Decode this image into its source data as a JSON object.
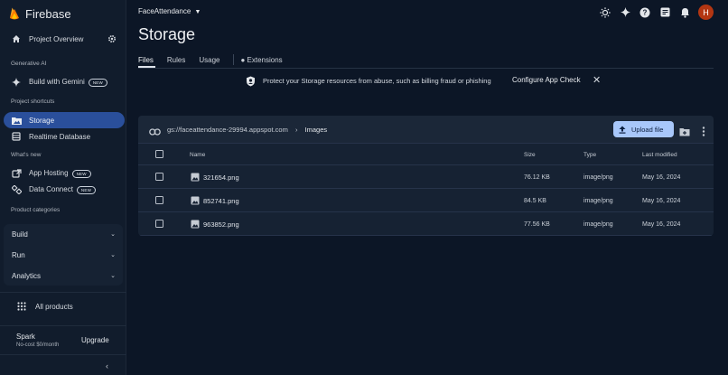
{
  "brand": {
    "name": "Firebase"
  },
  "sidebar": {
    "project_overview": "Project Overview",
    "generative_ai_label": "Generative AI",
    "build_with_gemini": "Build with Gemini",
    "new_badge": "NEW",
    "project_shortcuts_label": "Project shortcuts",
    "storage": "Storage",
    "realtime_database": "Realtime Database",
    "whats_new_label": "What's new",
    "app_hosting": "App Hosting",
    "data_connect": "Data Connect",
    "product_categories_label": "Product categories",
    "categories": [
      {
        "label": "Build"
      },
      {
        "label": "Run"
      },
      {
        "label": "Analytics"
      }
    ],
    "all_products": "All products",
    "plan_name": "Spark",
    "plan_sub": "No-cost $0/month",
    "upgrade": "Upgrade"
  },
  "header": {
    "project_name": "FaceAttendance",
    "avatar_initial": "H"
  },
  "page": {
    "title": "Storage",
    "tabs": [
      {
        "label": "Files"
      },
      {
        "label": "Rules"
      },
      {
        "label": "Usage"
      },
      {
        "label": "Extensions"
      }
    ]
  },
  "banner": {
    "text": "Protect your Storage resources from abuse, such as billing fraud or phishing",
    "action": "Configure App Check"
  },
  "browser": {
    "bucket": "gs://faceattendance-29994.appspot.com",
    "folder": "Images",
    "upload_label": "Upload file",
    "columns": {
      "name": "Name",
      "size": "Size",
      "type": "Type",
      "modified": "Last modified"
    },
    "files": [
      {
        "name": "321654.png",
        "size": "76.12 KB",
        "type": "image/png",
        "modified": "May 16, 2024"
      },
      {
        "name": "852741.png",
        "size": "84.5 KB",
        "type": "image/png",
        "modified": "May 16, 2024"
      },
      {
        "name": "963852.png",
        "size": "77.56 KB",
        "type": "image/png",
        "modified": "May 16, 2024"
      }
    ]
  },
  "colors": {
    "accent": "#a8c7fa",
    "active_nav": "#2a4f9b",
    "background": "#0c1626",
    "avatar": "#b33612"
  }
}
